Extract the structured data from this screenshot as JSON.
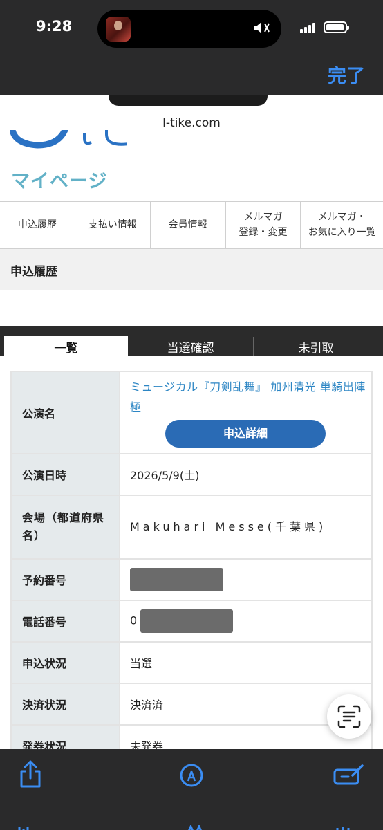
{
  "status_bar": {
    "time": "9:28"
  },
  "header": {
    "done_label": "完了"
  },
  "browser": {
    "url": "l-tike.com"
  },
  "page": {
    "title": "マイページ",
    "menu": [
      {
        "label": "申込履歴"
      },
      {
        "label": "支払い情報"
      },
      {
        "label": "会員情報"
      },
      {
        "label_line1": "メルマガ",
        "label_line2": "登録・変更"
      },
      {
        "label_line1": "メルマガ・",
        "label_line2": "お気に入り一覧"
      }
    ],
    "section_title": "申込履歴",
    "tabs": [
      {
        "label": "一覧",
        "active": true
      },
      {
        "label": "当選確認",
        "active": false
      },
      {
        "label": "未引取",
        "active": false
      }
    ],
    "table": {
      "event_name_label": "公演名",
      "event_name": "ミュージカル『刀剣乱舞』 加州清光 単騎出陣 極",
      "detail_button": "申込詳細",
      "date_label": "公演日時",
      "date": "2026/5/9(土)",
      "venue_label": "会場（都道府県名）",
      "venue": "Makuhari Messe(千葉県)",
      "reservation_label": "予約番号",
      "phone_label": "電話番号",
      "phone_prefix": "0",
      "status_label": "申込状況",
      "status": "当選",
      "payment_label": "決済状況",
      "payment": "決済済",
      "ticket_label": "発券状況",
      "ticket": "未発券"
    }
  },
  "colors": {
    "accent": "#3b8df3",
    "title_teal": "#62b1c7",
    "button_blue": "#2a6bb5",
    "status_red": "#c0392b"
  }
}
